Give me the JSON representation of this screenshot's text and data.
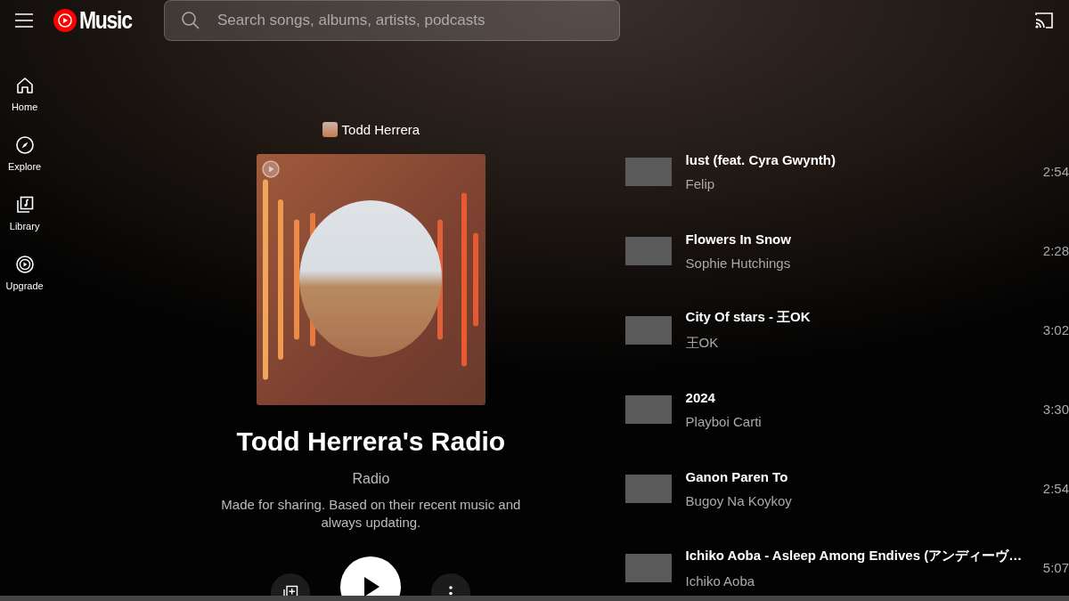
{
  "header": {
    "logo_text": "Music",
    "search": {
      "placeholder": "Search songs, albums, artists, podcasts"
    }
  },
  "nav": [
    {
      "label": "Home"
    },
    {
      "label": "Explore"
    },
    {
      "label": "Library"
    },
    {
      "label": "Upgrade"
    }
  ],
  "playlist": {
    "owner": "Todd Herrera",
    "title": "Todd Herrera's Radio",
    "type": "Radio",
    "description": "Made for sharing. Based on their recent music and always updating."
  },
  "tracks": [
    {
      "title": "lust (feat. Cyra Gwynth)",
      "artist": "Felip",
      "duration": "2:54"
    },
    {
      "title": "Flowers In Snow",
      "artist": "Sophie Hutchings",
      "duration": "2:28"
    },
    {
      "title": "City Of stars  - 王OK",
      "artist": "王OK",
      "duration": "3:02"
    },
    {
      "title": "2024",
      "artist": "Playboi Carti",
      "duration": "3:30"
    },
    {
      "title": "Ganon Paren To",
      "artist": "Bugoy Na Koykoy",
      "duration": "2:54"
    },
    {
      "title": "Ichiko Aoba - Asleep Among Endives (アンディーヴ…",
      "artist": "Ichiko Aoba",
      "duration": "5:07"
    }
  ]
}
